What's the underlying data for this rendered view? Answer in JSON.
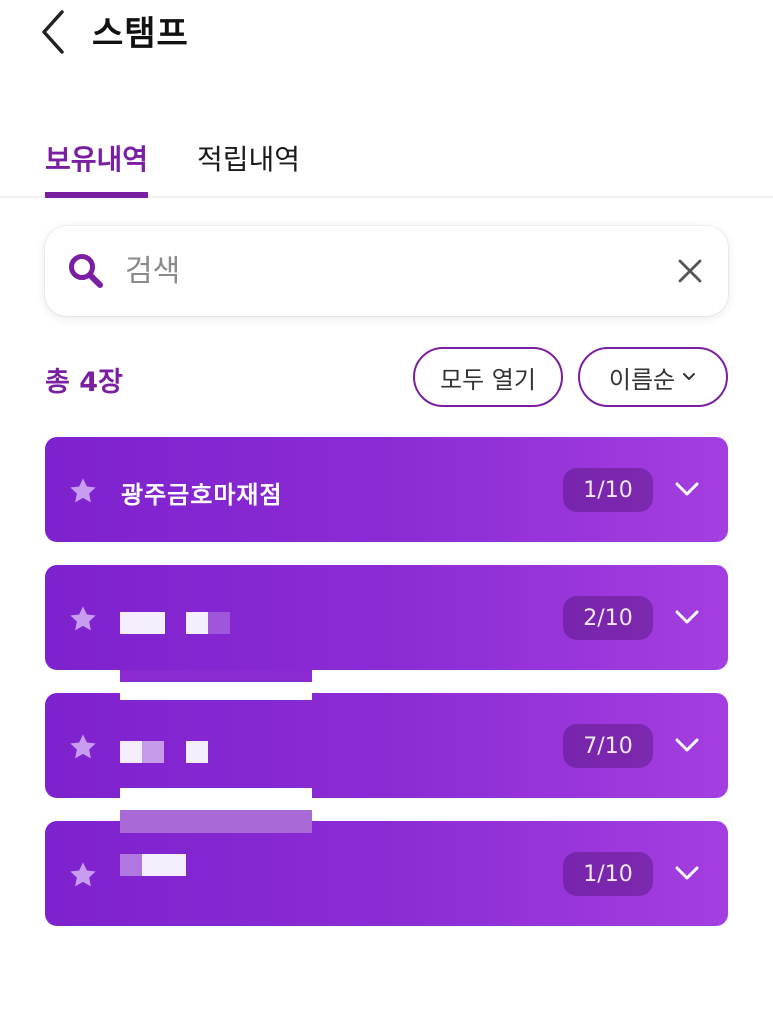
{
  "header": {
    "title": "스탬프"
  },
  "tabs": [
    {
      "label": "보유내역",
      "active": true
    },
    {
      "label": "적립내역",
      "active": false
    }
  ],
  "search": {
    "placeholder": "검색",
    "value": ""
  },
  "summary": {
    "total_label": "총 4장",
    "open_all_label": "모두 열기",
    "sort_label": "이름순"
  },
  "stamps": [
    {
      "name": "광주금호마재점",
      "count": "1/10"
    },
    {
      "name": "",
      "count": "2/10"
    },
    {
      "name": "",
      "count": "7/10"
    },
    {
      "name": "",
      "count": "1/10"
    }
  ],
  "colors": {
    "accent": "#7b1fa2",
    "card_start": "#7e22ce",
    "card_end": "#a43ee0"
  },
  "icons": [
    "back-arrow-icon",
    "search-icon",
    "close-icon",
    "chevron-down-icon",
    "star-icon"
  ]
}
